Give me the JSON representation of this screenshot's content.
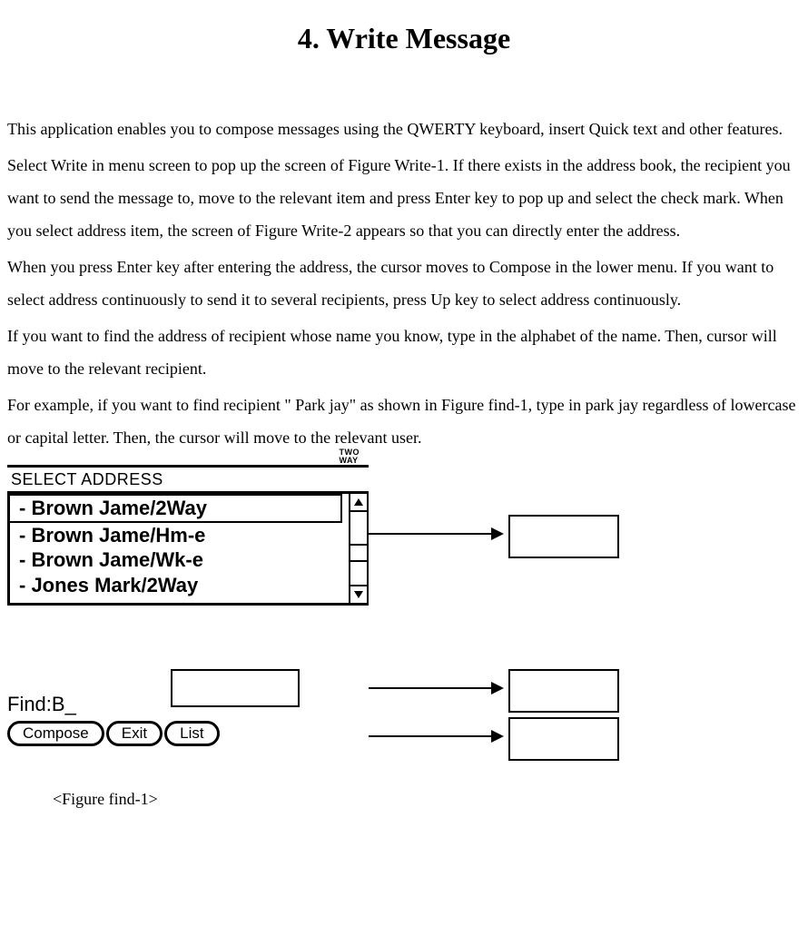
{
  "title": "4. Write Message",
  "paragraphs": {
    "p1": "This application enables you to compose messages using the QWERTY keyboard, insert Quick text and other features.",
    "p2": "Select Write in menu screen to pop up the screen of Figure Write-1. If there exists in the address book, the recipient you want to send the message to, move to the relevant item and press Enter key to pop up and select the check mark. When you select address item, the screen of Figure Write-2 appears so that you can directly enter the address.",
    "p3": "When you press Enter key after entering the address, the cursor moves to Compose in the lower menu. If you want to select address continuously to send it to several recipients, press Up key to select address continuously.",
    "p4": "If you want to find the address of recipient whose name you know, type in the alphabet of the name. Then, cursor will move to the relevant recipient.",
    "p5": "For example, if you want to find recipient \" Park jay\" as shown in Figure find-1, type in park jay regardless of lowercase or capital letter. Then, the cursor will move to the relevant user."
  },
  "device": {
    "two_way_label": "TWO\nWAY",
    "header": "SELECT ADDRESS",
    "addresses": [
      "- Brown Jame/2Way",
      "- Brown Jame/Hm-e",
      "- Brown Jame/Wk-e",
      "- Jones Mark/2Way"
    ],
    "selected_index": 0,
    "find_label": "Find:",
    "find_value": "B_",
    "buttons": {
      "compose": "Compose",
      "exit": "Exit",
      "list": "List"
    }
  },
  "caption": "<Figure find-1>"
}
